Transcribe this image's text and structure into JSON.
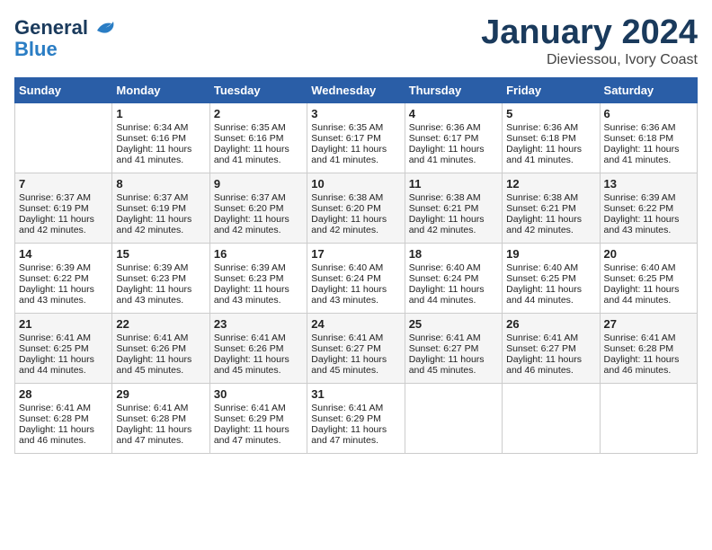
{
  "header": {
    "logo_general": "General",
    "logo_blue": "Blue",
    "title": "January 2024",
    "location": "Dieviessou, Ivory Coast"
  },
  "days_of_week": [
    "Sunday",
    "Monday",
    "Tuesday",
    "Wednesday",
    "Thursday",
    "Friday",
    "Saturday"
  ],
  "weeks": [
    [
      {
        "day": "",
        "sunrise": "",
        "sunset": "",
        "daylight": ""
      },
      {
        "day": "1",
        "sunrise": "Sunrise: 6:34 AM",
        "sunset": "Sunset: 6:16 PM",
        "daylight": "Daylight: 11 hours and 41 minutes."
      },
      {
        "day": "2",
        "sunrise": "Sunrise: 6:35 AM",
        "sunset": "Sunset: 6:16 PM",
        "daylight": "Daylight: 11 hours and 41 minutes."
      },
      {
        "day": "3",
        "sunrise": "Sunrise: 6:35 AM",
        "sunset": "Sunset: 6:17 PM",
        "daylight": "Daylight: 11 hours and 41 minutes."
      },
      {
        "day": "4",
        "sunrise": "Sunrise: 6:36 AM",
        "sunset": "Sunset: 6:17 PM",
        "daylight": "Daylight: 11 hours and 41 minutes."
      },
      {
        "day": "5",
        "sunrise": "Sunrise: 6:36 AM",
        "sunset": "Sunset: 6:18 PM",
        "daylight": "Daylight: 11 hours and 41 minutes."
      },
      {
        "day": "6",
        "sunrise": "Sunrise: 6:36 AM",
        "sunset": "Sunset: 6:18 PM",
        "daylight": "Daylight: 11 hours and 41 minutes."
      }
    ],
    [
      {
        "day": "7",
        "sunrise": "Sunrise: 6:37 AM",
        "sunset": "Sunset: 6:19 PM",
        "daylight": "Daylight: 11 hours and 42 minutes."
      },
      {
        "day": "8",
        "sunrise": "Sunrise: 6:37 AM",
        "sunset": "Sunset: 6:19 PM",
        "daylight": "Daylight: 11 hours and 42 minutes."
      },
      {
        "day": "9",
        "sunrise": "Sunrise: 6:37 AM",
        "sunset": "Sunset: 6:20 PM",
        "daylight": "Daylight: 11 hours and 42 minutes."
      },
      {
        "day": "10",
        "sunrise": "Sunrise: 6:38 AM",
        "sunset": "Sunset: 6:20 PM",
        "daylight": "Daylight: 11 hours and 42 minutes."
      },
      {
        "day": "11",
        "sunrise": "Sunrise: 6:38 AM",
        "sunset": "Sunset: 6:21 PM",
        "daylight": "Daylight: 11 hours and 42 minutes."
      },
      {
        "day": "12",
        "sunrise": "Sunrise: 6:38 AM",
        "sunset": "Sunset: 6:21 PM",
        "daylight": "Daylight: 11 hours and 42 minutes."
      },
      {
        "day": "13",
        "sunrise": "Sunrise: 6:39 AM",
        "sunset": "Sunset: 6:22 PM",
        "daylight": "Daylight: 11 hours and 43 minutes."
      }
    ],
    [
      {
        "day": "14",
        "sunrise": "Sunrise: 6:39 AM",
        "sunset": "Sunset: 6:22 PM",
        "daylight": "Daylight: 11 hours and 43 minutes."
      },
      {
        "day": "15",
        "sunrise": "Sunrise: 6:39 AM",
        "sunset": "Sunset: 6:23 PM",
        "daylight": "Daylight: 11 hours and 43 minutes."
      },
      {
        "day": "16",
        "sunrise": "Sunrise: 6:39 AM",
        "sunset": "Sunset: 6:23 PM",
        "daylight": "Daylight: 11 hours and 43 minutes."
      },
      {
        "day": "17",
        "sunrise": "Sunrise: 6:40 AM",
        "sunset": "Sunset: 6:24 PM",
        "daylight": "Daylight: 11 hours and 43 minutes."
      },
      {
        "day": "18",
        "sunrise": "Sunrise: 6:40 AM",
        "sunset": "Sunset: 6:24 PM",
        "daylight": "Daylight: 11 hours and 44 minutes."
      },
      {
        "day": "19",
        "sunrise": "Sunrise: 6:40 AM",
        "sunset": "Sunset: 6:25 PM",
        "daylight": "Daylight: 11 hours and 44 minutes."
      },
      {
        "day": "20",
        "sunrise": "Sunrise: 6:40 AM",
        "sunset": "Sunset: 6:25 PM",
        "daylight": "Daylight: 11 hours and 44 minutes."
      }
    ],
    [
      {
        "day": "21",
        "sunrise": "Sunrise: 6:41 AM",
        "sunset": "Sunset: 6:25 PM",
        "daylight": "Daylight: 11 hours and 44 minutes."
      },
      {
        "day": "22",
        "sunrise": "Sunrise: 6:41 AM",
        "sunset": "Sunset: 6:26 PM",
        "daylight": "Daylight: 11 hours and 45 minutes."
      },
      {
        "day": "23",
        "sunrise": "Sunrise: 6:41 AM",
        "sunset": "Sunset: 6:26 PM",
        "daylight": "Daylight: 11 hours and 45 minutes."
      },
      {
        "day": "24",
        "sunrise": "Sunrise: 6:41 AM",
        "sunset": "Sunset: 6:27 PM",
        "daylight": "Daylight: 11 hours and 45 minutes."
      },
      {
        "day": "25",
        "sunrise": "Sunrise: 6:41 AM",
        "sunset": "Sunset: 6:27 PM",
        "daylight": "Daylight: 11 hours and 45 minutes."
      },
      {
        "day": "26",
        "sunrise": "Sunrise: 6:41 AM",
        "sunset": "Sunset: 6:27 PM",
        "daylight": "Daylight: 11 hours and 46 minutes."
      },
      {
        "day": "27",
        "sunrise": "Sunrise: 6:41 AM",
        "sunset": "Sunset: 6:28 PM",
        "daylight": "Daylight: 11 hours and 46 minutes."
      }
    ],
    [
      {
        "day": "28",
        "sunrise": "Sunrise: 6:41 AM",
        "sunset": "Sunset: 6:28 PM",
        "daylight": "Daylight: 11 hours and 46 minutes."
      },
      {
        "day": "29",
        "sunrise": "Sunrise: 6:41 AM",
        "sunset": "Sunset: 6:28 PM",
        "daylight": "Daylight: 11 hours and 47 minutes."
      },
      {
        "day": "30",
        "sunrise": "Sunrise: 6:41 AM",
        "sunset": "Sunset: 6:29 PM",
        "daylight": "Daylight: 11 hours and 47 minutes."
      },
      {
        "day": "31",
        "sunrise": "Sunrise: 6:41 AM",
        "sunset": "Sunset: 6:29 PM",
        "daylight": "Daylight: 11 hours and 47 minutes."
      },
      {
        "day": "",
        "sunrise": "",
        "sunset": "",
        "daylight": ""
      },
      {
        "day": "",
        "sunrise": "",
        "sunset": "",
        "daylight": ""
      },
      {
        "day": "",
        "sunrise": "",
        "sunset": "",
        "daylight": ""
      }
    ]
  ]
}
